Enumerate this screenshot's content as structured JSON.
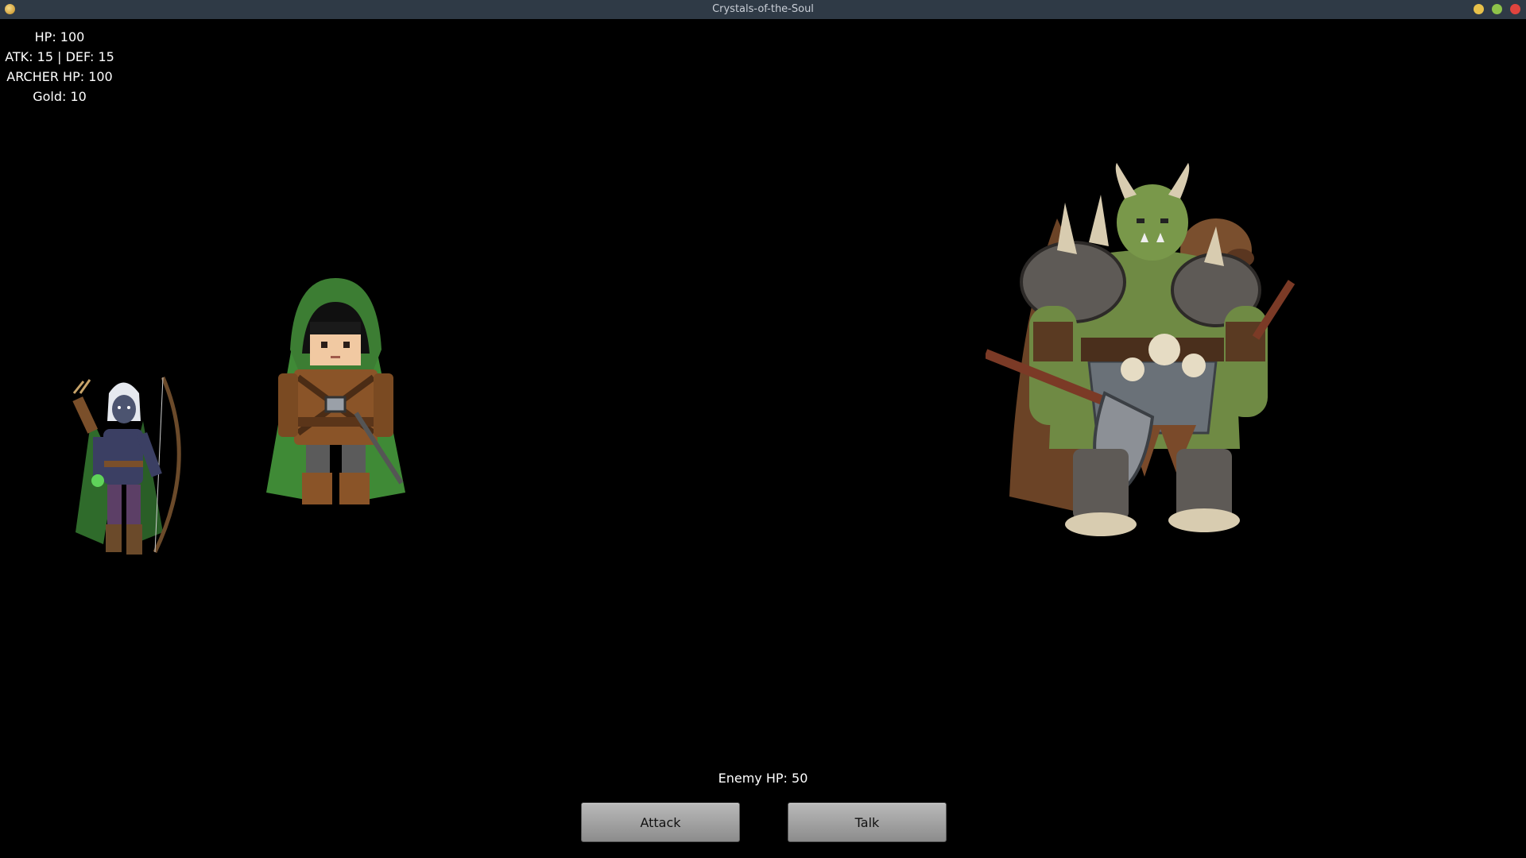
{
  "window": {
    "title": "Crystals-of-the-Soul",
    "icon": "app-icon",
    "controls": [
      "minimize-icon",
      "maximize-icon",
      "close-icon"
    ]
  },
  "hud": {
    "hp": "HP: 100",
    "atk_def": "ATK: 15 | DEF: 15",
    "archer_hp": "ARCHER HP: 100",
    "gold": "Gold: 10"
  },
  "battle": {
    "enemy_hp": "Enemy HP: 50"
  },
  "actions": {
    "attack_label": "Attack",
    "talk_label": "Talk"
  },
  "colors": {
    "background": "#000000",
    "titlebar": "#2f3a46",
    "button": "#a3a3a3",
    "text": "#ffffff"
  }
}
